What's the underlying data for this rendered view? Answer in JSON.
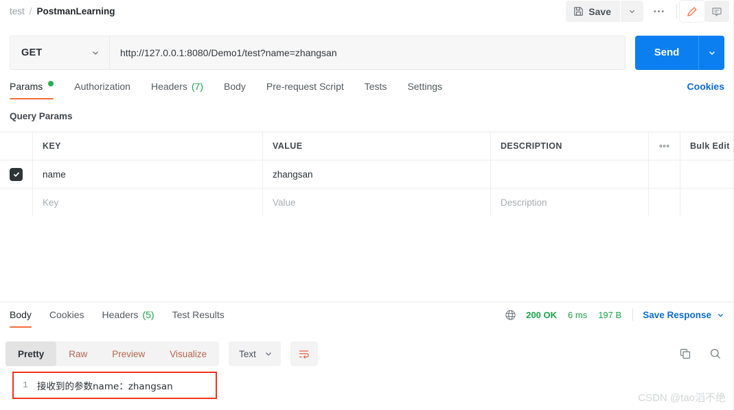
{
  "breadcrumb": {
    "parent": "test",
    "separator": "/",
    "current": "PostmanLearning"
  },
  "toolbar": {
    "save_label": "Save",
    "save_icon": "floppy-disk-icon",
    "save_caret_icon": "chevron-down-icon",
    "more_icon": "three-dots-icon",
    "edit_icon": "pencil-icon",
    "comment_icon": "comment-icon",
    "accent_orange": "#ff6c37"
  },
  "request": {
    "method": "GET",
    "method_caret_icon": "chevron-down-icon",
    "url": "http://127.0.0.1:8080/Demo1/test?name=zhangsan",
    "send_label": "Send",
    "send_caret_icon": "chevron-down-icon",
    "send_color": "#0b7ff0"
  },
  "request_tabs": [
    {
      "label": "Params",
      "active": true,
      "indicator": "green-dot",
      "count": ""
    },
    {
      "label": "Authorization",
      "active": false,
      "indicator": "",
      "count": ""
    },
    {
      "label": "Headers",
      "active": false,
      "indicator": "",
      "count": "(7)"
    },
    {
      "label": "Body",
      "active": false,
      "indicator": "",
      "count": ""
    },
    {
      "label": "Pre-request Script",
      "active": false,
      "indicator": "",
      "count": ""
    },
    {
      "label": "Tests",
      "active": false,
      "indicator": "",
      "count": ""
    },
    {
      "label": "Settings",
      "active": false,
      "indicator": "",
      "count": ""
    }
  ],
  "cookies_link": "Cookies",
  "query_params": {
    "title": "Query Params",
    "columns": [
      "KEY",
      "VALUE",
      "DESCRIPTION"
    ],
    "more_icon": "three-dots-icon",
    "bulk_edit_label": "Bulk Edit",
    "rows": [
      {
        "checked": true,
        "key": "name",
        "value": "zhangsan",
        "description": "",
        "placeholder": false
      },
      {
        "checked": false,
        "key": "Key",
        "value": "Value",
        "description": "Description",
        "placeholder": true
      }
    ]
  },
  "response_tabs": [
    {
      "label": "Body",
      "active": true,
      "count": ""
    },
    {
      "label": "Cookies",
      "active": false,
      "count": ""
    },
    {
      "label": "Headers",
      "active": false,
      "count": "(5)"
    },
    {
      "label": "Test Results",
      "active": false,
      "count": ""
    }
  ],
  "response_status": {
    "globe_icon": "globe-icon",
    "status": "200 OK",
    "time": "6 ms",
    "size": "197 B",
    "save_response_label": "Save Response",
    "save_response_caret_icon": "chevron-down-icon",
    "status_color": "#1aa34a",
    "link_color": "#0b6bd6"
  },
  "body_toolbar": {
    "views": [
      {
        "label": "Pretty",
        "active": true
      },
      {
        "label": "Raw",
        "active": false
      },
      {
        "label": "Preview",
        "active": false
      },
      {
        "label": "Visualize",
        "active": false
      }
    ],
    "format": "Text",
    "format_caret_icon": "chevron-down-icon",
    "wrap_icon": "word-wrap-icon",
    "copy_icon": "copy-icon",
    "search_icon": "search-icon"
  },
  "response_body": {
    "line_number": "1",
    "content": "接收到的参数name：zhangsan",
    "highlight_color": "#f2331f"
  },
  "watermark": "CSDN @tao滔不绝"
}
